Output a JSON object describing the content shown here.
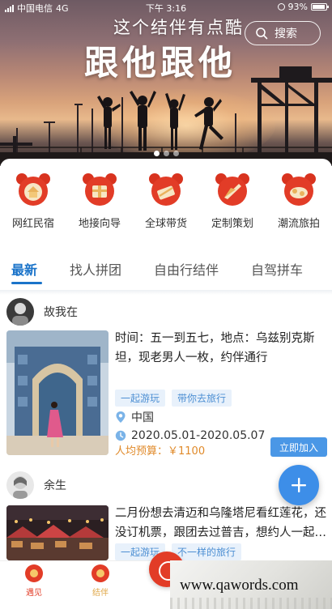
{
  "status_bar": {
    "carrier": "中国电信",
    "network": "4G",
    "time": "下午 3:16",
    "battery": "93%"
  },
  "banner": {
    "subtitle": "这个结伴有点酷",
    "title": "跟他跟他",
    "search_label": "搜索",
    "page_dots": 3,
    "active_dot": 0
  },
  "categories": [
    {
      "label": "网红民宿",
      "icon": "homestay-icon"
    },
    {
      "label": "地接向导",
      "icon": "guide-gift-icon"
    },
    {
      "label": "全球带货",
      "icon": "global-shopping-icon"
    },
    {
      "label": "定制策划",
      "icon": "custom-plan-icon"
    },
    {
      "label": "潮流旅拍",
      "icon": "travel-photo-icon"
    }
  ],
  "tabs": [
    "最新",
    "找人拼团",
    "自由行结伴",
    "自驾拼车"
  ],
  "active_tab": 0,
  "posts": [
    {
      "username": "故我在",
      "text": "时间：五一到五七，地点：乌兹别克斯坦，现老男人一枚，约伴通行",
      "tags": [
        "一起游玩",
        "带你去旅行"
      ],
      "location": "中国",
      "dates": "2020.05.01-2020.05.07",
      "budget": "人均预算：￥1100",
      "join_label": "立即加入"
    },
    {
      "username": "余生",
      "text": "二月份想去清迈和乌隆塔尼看红莲花，还没订机票，跟团去过普吉，想约人一起…",
      "tags": [
        "一起游玩",
        "不一样的旅行"
      ]
    }
  ],
  "bottom_nav": [
    {
      "label": "遇见",
      "color": "#e23c27"
    },
    {
      "label": "结伴",
      "color": "#e0a84a"
    }
  ],
  "watermark": "www.qawords.com",
  "colors": {
    "accent": "#1a73c9",
    "tag_bg": "#e8f1fb",
    "tag_text": "#4d8fd3",
    "budget": "#e08a2a",
    "join": "#4a97e6",
    "icon_red": "#e23c27"
  }
}
